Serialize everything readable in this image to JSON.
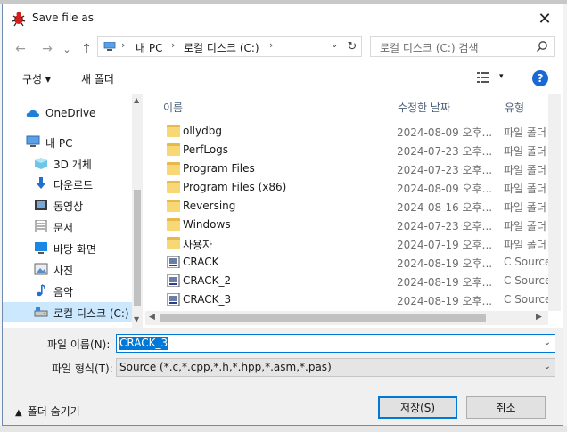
{
  "window": {
    "title": "Save file as",
    "close_glyph": "✕"
  },
  "nav": {
    "back_glyph": "←",
    "forward_glyph": "→",
    "recent_glyph": "⌄",
    "up_glyph": "↑",
    "breadcrumb": [
      "내 PC",
      "로컬 디스크 (C:)"
    ],
    "crumb_sep": "›",
    "refresh_glyph": "↻",
    "search_placeholder": "로컬 디스크 (C:) 검색"
  },
  "toolbar": {
    "organize_label": "구성 ▾",
    "new_folder_label": "새 폴더",
    "view_dd": "▾",
    "help_label": "?"
  },
  "sidebar": {
    "items": [
      {
        "label": "OneDrive",
        "icon": "cloud-icon"
      },
      {
        "label": "내 PC",
        "icon": "pc-icon"
      },
      {
        "label": "3D 개체",
        "icon": "cube-3d-icon"
      },
      {
        "label": "다운로드",
        "icon": "download-icon"
      },
      {
        "label": "동영상",
        "icon": "video-icon"
      },
      {
        "label": "문서",
        "icon": "document-icon"
      },
      {
        "label": "바탕 화면",
        "icon": "desktop-icon"
      },
      {
        "label": "사진",
        "icon": "picture-icon"
      },
      {
        "label": "음악",
        "icon": "music-icon"
      },
      {
        "label": "로컬 디스크 (C:)",
        "icon": "drive-icon"
      }
    ],
    "selected": "로컬 디스크 (C:)"
  },
  "files": {
    "columns": [
      "이름",
      "수정한 날짜",
      "유형"
    ],
    "rows": [
      {
        "name": "ollydbg",
        "date": "2024-08-09 오후...",
        "type": "파일 폴더",
        "kind": "folder"
      },
      {
        "name": "PerfLogs",
        "date": "2024-07-23 오후...",
        "type": "파일 폴더",
        "kind": "folder"
      },
      {
        "name": "Program Files",
        "date": "2024-07-23 오후...",
        "type": "파일 폴더",
        "kind": "folder"
      },
      {
        "name": "Program Files (x86)",
        "date": "2024-08-09 오후...",
        "type": "파일 폴더",
        "kind": "folder"
      },
      {
        "name": "Reversing",
        "date": "2024-08-16 오후...",
        "type": "파일 폴더",
        "kind": "folder"
      },
      {
        "name": "Windows",
        "date": "2024-07-23 오후...",
        "type": "파일 폴더",
        "kind": "folder"
      },
      {
        "name": "사용자",
        "date": "2024-07-19 오후...",
        "type": "파일 폴더",
        "kind": "folder"
      },
      {
        "name": "CRACK",
        "date": "2024-08-19 오후...",
        "type": "C Source",
        "kind": "source"
      },
      {
        "name": "CRACK_2",
        "date": "2024-08-19 오후...",
        "type": "C Source",
        "kind": "source"
      },
      {
        "name": "CRACK_3",
        "date": "2024-08-19 오후...",
        "type": "C Source",
        "kind": "source"
      }
    ]
  },
  "form": {
    "filename_label": "파일 이름(N):",
    "filename_value": "CRACK_3",
    "filetype_label": "파일 형식(T):",
    "filetype_value": "Source (*.c,*.cpp,*.h,*.hpp,*.asm,*.pas)",
    "hide_folders_label": "폴더 숨기기",
    "save_label": "저장(S)",
    "cancel_label": "취소"
  },
  "colors": {
    "accent": "#0078d7",
    "selection": "#cce8ff",
    "help": "#1a68d5",
    "folder": "#f8d775"
  }
}
